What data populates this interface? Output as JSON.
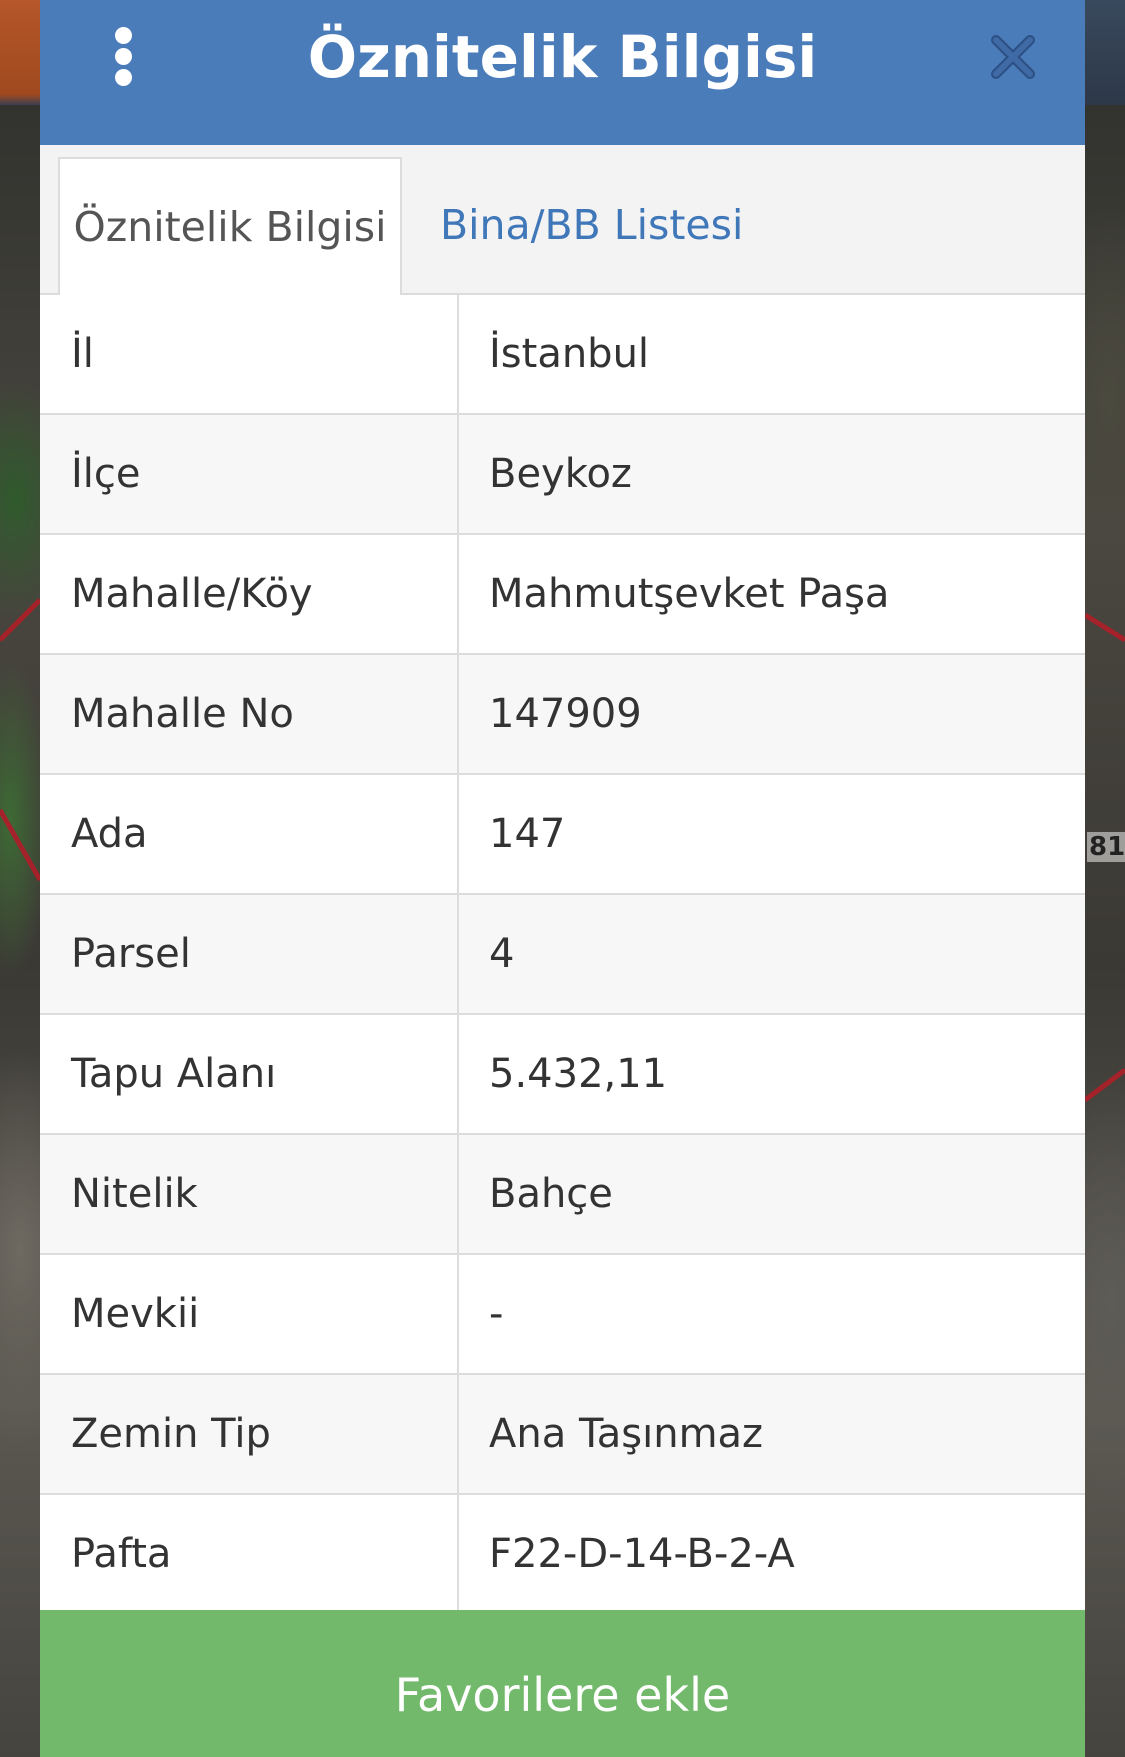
{
  "dialog": {
    "title": "Öznitelik Bilgisi",
    "menu_icon": "vertical-dots-icon",
    "close_icon": "close-x-icon"
  },
  "tabs": [
    {
      "label": "Öznitelik Bilgisi",
      "active": true
    },
    {
      "label": "Bina/BB Listesi",
      "active": false
    }
  ],
  "attributes": [
    {
      "key": "İl",
      "value": "İstanbul"
    },
    {
      "key": "İlçe",
      "value": "Beykoz"
    },
    {
      "key": "Mahalle/Köy",
      "value": "Mahmutşevket Paşa"
    },
    {
      "key": "Mahalle No",
      "value": "147909"
    },
    {
      "key": "Ada",
      "value": "147"
    },
    {
      "key": "Parsel",
      "value": "4"
    },
    {
      "key": "Tapu Alanı",
      "value": "5.432,11"
    },
    {
      "key": "Nitelik",
      "value": "Bahçe"
    },
    {
      "key": "Mevkii",
      "value": "-"
    },
    {
      "key": "Zemin Tip",
      "value": "Ana Taşınmaz"
    },
    {
      "key": "Pafta",
      "value": "F22-D-14-B-2-A"
    }
  ],
  "footer": {
    "favorite_label": "Favorilere ekle"
  },
  "map": {
    "edge_label": "81"
  },
  "colors": {
    "header": "#4b7cba",
    "tab_link": "#3f77b9",
    "button": "#72b96c",
    "parcel_border": "#a5222a"
  }
}
